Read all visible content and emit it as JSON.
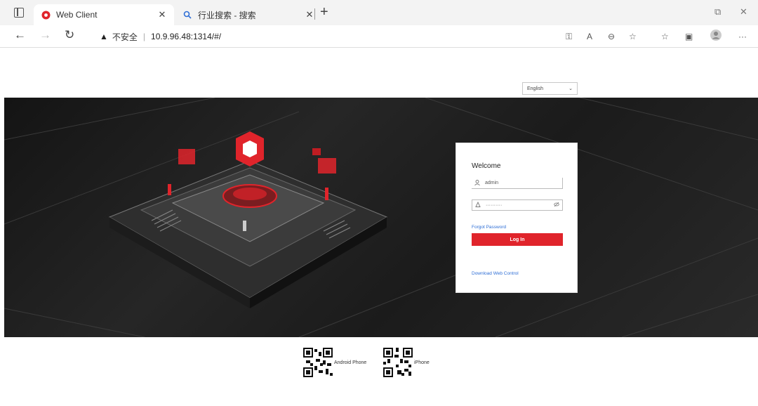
{
  "browser": {
    "tabs": [
      {
        "title": "Web Client",
        "active": true
      },
      {
        "title": "行业搜索 - 搜索",
        "active": false
      }
    ],
    "address": {
      "security_label": "不安全",
      "url": "10.9.96.48:1314/#/"
    }
  },
  "page": {
    "language": {
      "selected": "English"
    },
    "login": {
      "welcome": "Welcome",
      "username_value": "admin",
      "password_value": "··········",
      "forgot_label": "Forgot Password",
      "login_label": "Log In",
      "download_label": "Download Web Control"
    },
    "apps": [
      {
        "label": "Android Phone"
      },
      {
        "label": "iPhone"
      }
    ]
  },
  "colors": {
    "accent": "#e0242b",
    "link": "#2f6fd6"
  }
}
